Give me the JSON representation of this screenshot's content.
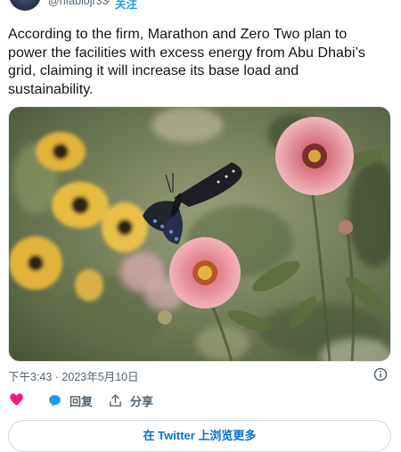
{
  "header": {
    "handle": "@hfabiojr33",
    "separator": "·",
    "follow_label": "关注"
  },
  "tweet": {
    "text": "According to the firm, Marathon and Zero Two plan to power the facilities with excess energy from Abu Dhabi’s grid, claiming it will increase its base load and sustainability."
  },
  "meta": {
    "timestamp": "下午3:43 · 2023年5月10日"
  },
  "actions": {
    "like_icon": "heart-icon",
    "reply_label": "回复",
    "reply_icon": "comment-icon",
    "share_label": "分享",
    "share_icon": "share-icon"
  },
  "bottom": {
    "label": "在 Twitter 上浏览更多"
  },
  "colors": {
    "accent": "#1d9bf0",
    "like": "#f91880",
    "muted": "#536471"
  }
}
